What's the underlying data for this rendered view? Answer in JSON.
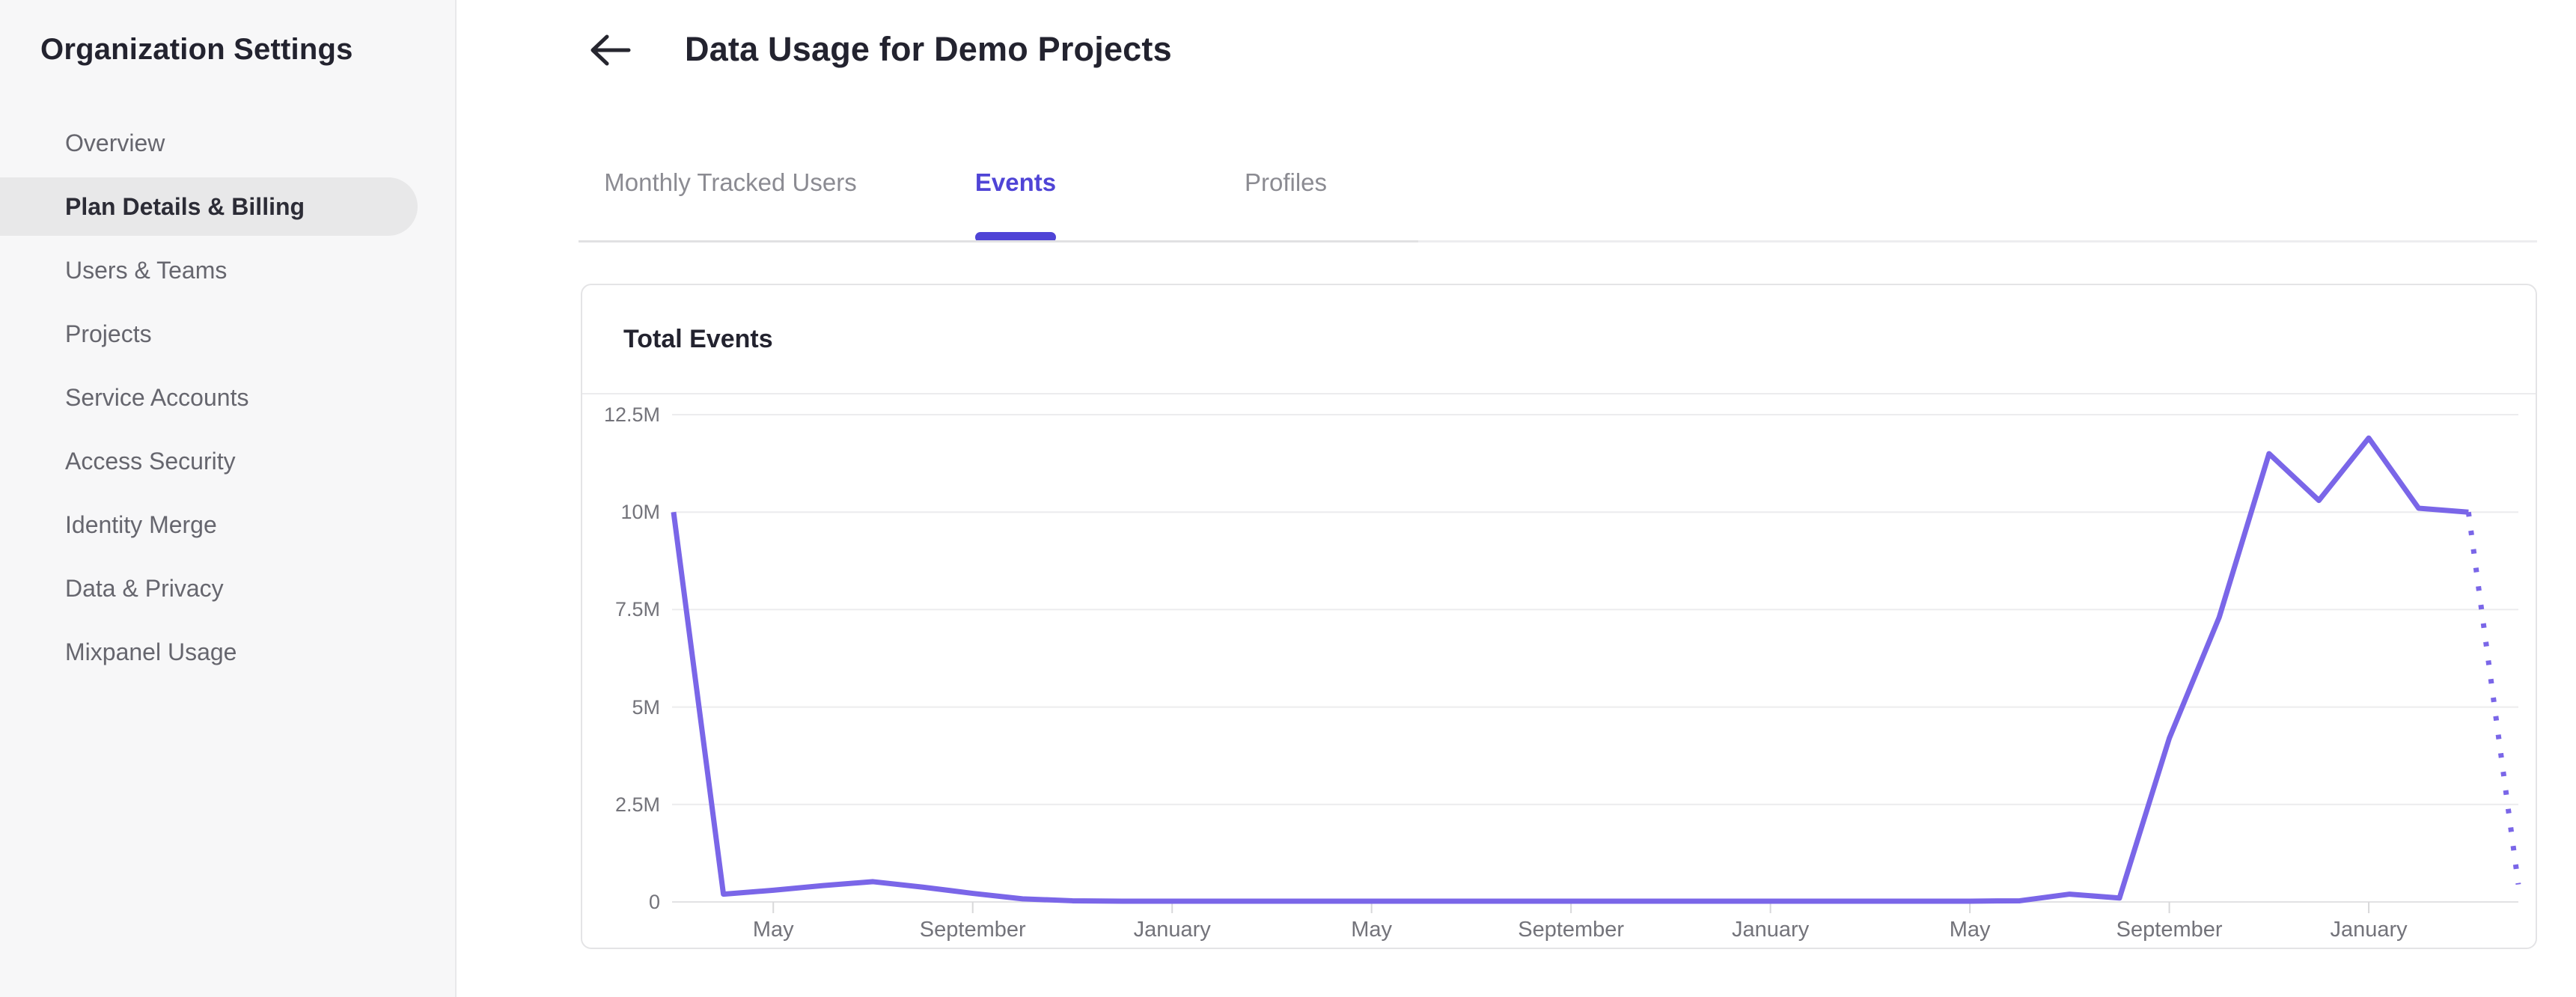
{
  "sidebar": {
    "title": "Organization Settings",
    "items": [
      {
        "label": "Overview",
        "active": false
      },
      {
        "label": "Plan Details & Billing",
        "active": true
      },
      {
        "label": "Users & Teams",
        "active": false
      },
      {
        "label": "Projects",
        "active": false
      },
      {
        "label": "Service Accounts",
        "active": false
      },
      {
        "label": "Access Security",
        "active": false
      },
      {
        "label": "Identity Merge",
        "active": false
      },
      {
        "label": "Data & Privacy",
        "active": false
      },
      {
        "label": "Mixpanel Usage",
        "active": false
      }
    ]
  },
  "header": {
    "title": "Data Usage for Demo Projects",
    "back_icon": "left-arrow-icon"
  },
  "tabs": [
    {
      "label": "Monthly Tracked Users",
      "active": false
    },
    {
      "label": "Events",
      "active": true
    },
    {
      "label": "Profiles",
      "active": false
    }
  ],
  "colors": {
    "accent": "#4f44d6",
    "chart_line": "#7a66e8",
    "text_dark": "#26262f",
    "text_muted": "#73737a",
    "grid": "#ececee"
  },
  "chart_data": {
    "type": "line",
    "title": "Total Events",
    "series_name": "Total Events",
    "unit": "events per month (millions)",
    "ylim": [
      0,
      12.5
    ],
    "grid": true,
    "legend": "none",
    "y_tick_labels": [
      "12.5M",
      "10M",
      "7.5M",
      "5M",
      "2.5M",
      "0"
    ],
    "x_tick_labels": [
      "May",
      "September",
      "January",
      "May",
      "September",
      "January",
      "May",
      "September",
      "January"
    ],
    "x_tick_point_indices": [
      2,
      6,
      10,
      14,
      18,
      22,
      26,
      30,
      34
    ],
    "values_millions": [
      10.0,
      0.2,
      0.3,
      0.42,
      0.52,
      0.38,
      0.22,
      0.08,
      0.03,
      0.02,
      0.02,
      0.02,
      0.02,
      0.02,
      0.02,
      0.02,
      0.02,
      0.02,
      0.02,
      0.02,
      0.02,
      0.02,
      0.02,
      0.02,
      0.02,
      0.02,
      0.02,
      0.03,
      0.2,
      0.1,
      4.2,
      7.3,
      11.5,
      10.3,
      11.9,
      10.1,
      10.0,
      0.45
    ],
    "last_point_projected_dotted": true
  }
}
